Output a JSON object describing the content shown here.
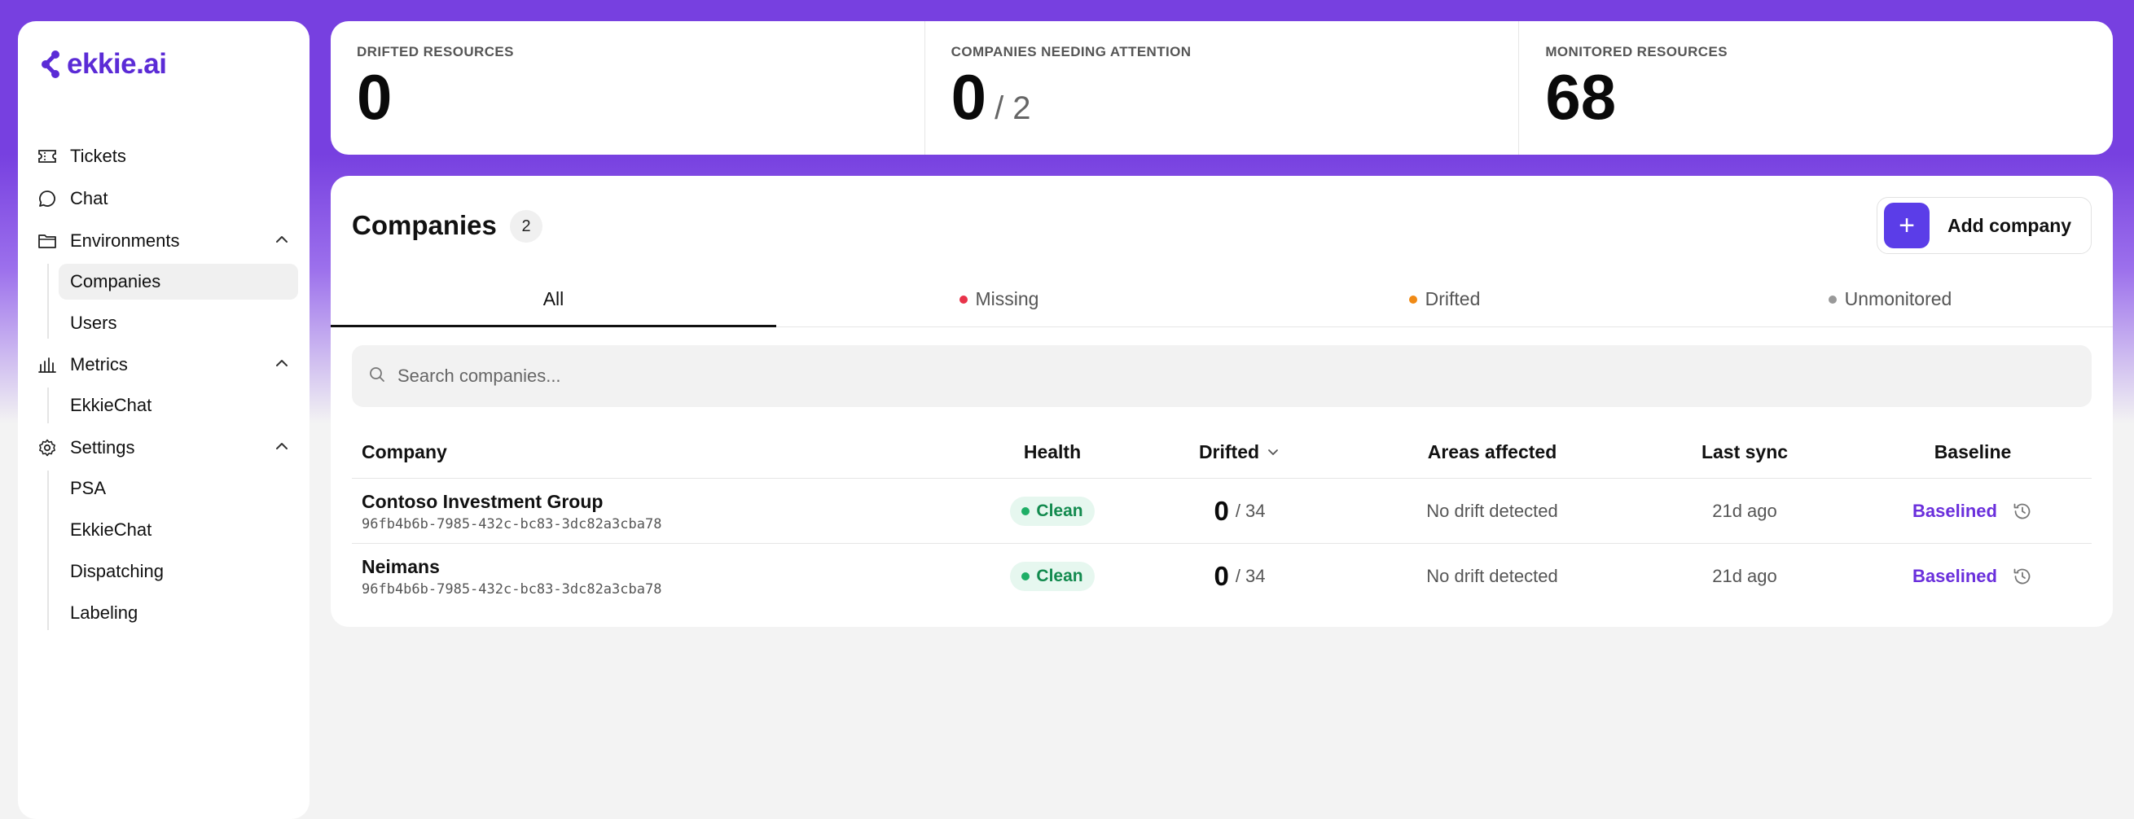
{
  "brand": {
    "name": "ekkie.ai",
    "color": "#5b2bd6"
  },
  "sidebar": {
    "items": [
      {
        "label": "Tickets",
        "icon": "ticket-icon"
      },
      {
        "label": "Chat",
        "icon": "chat-icon"
      },
      {
        "label": "Environments",
        "icon": "folder-icon",
        "expanded": true,
        "children": [
          {
            "label": "Companies",
            "active": true
          },
          {
            "label": "Users"
          }
        ]
      },
      {
        "label": "Metrics",
        "icon": "bar-chart-icon",
        "expanded": true,
        "children": [
          {
            "label": "EkkieChat"
          }
        ]
      },
      {
        "label": "Settings",
        "icon": "gear-icon",
        "expanded": true,
        "children": [
          {
            "label": "PSA"
          },
          {
            "label": "EkkieChat"
          },
          {
            "label": "Dispatching"
          },
          {
            "label": "Labeling"
          }
        ]
      }
    ]
  },
  "stats": [
    {
      "label": "DRIFTED RESOURCES",
      "value": "0",
      "sub": ""
    },
    {
      "label": "COMPANIES NEEDING ATTENTION",
      "value": "0",
      "sub": "/ 2"
    },
    {
      "label": "MONITORED RESOURCES",
      "value": "68",
      "sub": ""
    }
  ],
  "companies": {
    "title": "Companies",
    "count": "2",
    "add_label": "Add company",
    "tabs": [
      {
        "label": "All",
        "active": true,
        "dot": ""
      },
      {
        "label": "Missing",
        "dot": "#e8334a"
      },
      {
        "label": "Drifted",
        "dot": "#f08a16"
      },
      {
        "label": "Unmonitored",
        "dot": "#999999"
      }
    ],
    "search_placeholder": "Search companies...",
    "columns": {
      "company": "Company",
      "health": "Health",
      "drifted": "Drifted",
      "areas": "Areas affected",
      "last_sync": "Last sync",
      "baseline": "Baseline"
    },
    "rows": [
      {
        "name": "Contoso Investment Group",
        "id": "96fb4b6b-7985-432c-bc83-3dc82a3cba78",
        "health": "Clean",
        "drifted": "0",
        "drift_total": "/ 34",
        "areas": "No drift detected",
        "last_sync": "21d ago",
        "baseline": "Baselined"
      },
      {
        "name": "Neimans",
        "id": "96fb4b6b-7985-432c-bc83-3dc82a3cba78",
        "health": "Clean",
        "drifted": "0",
        "drift_total": "/ 34",
        "areas": "No drift detected",
        "last_sync": "21d ago",
        "baseline": "Baselined"
      }
    ]
  },
  "colors": {
    "accent": "#7740e0",
    "primary_button": "#5b3de8",
    "healthy": "#128a4e",
    "link": "#6a2fdc"
  }
}
